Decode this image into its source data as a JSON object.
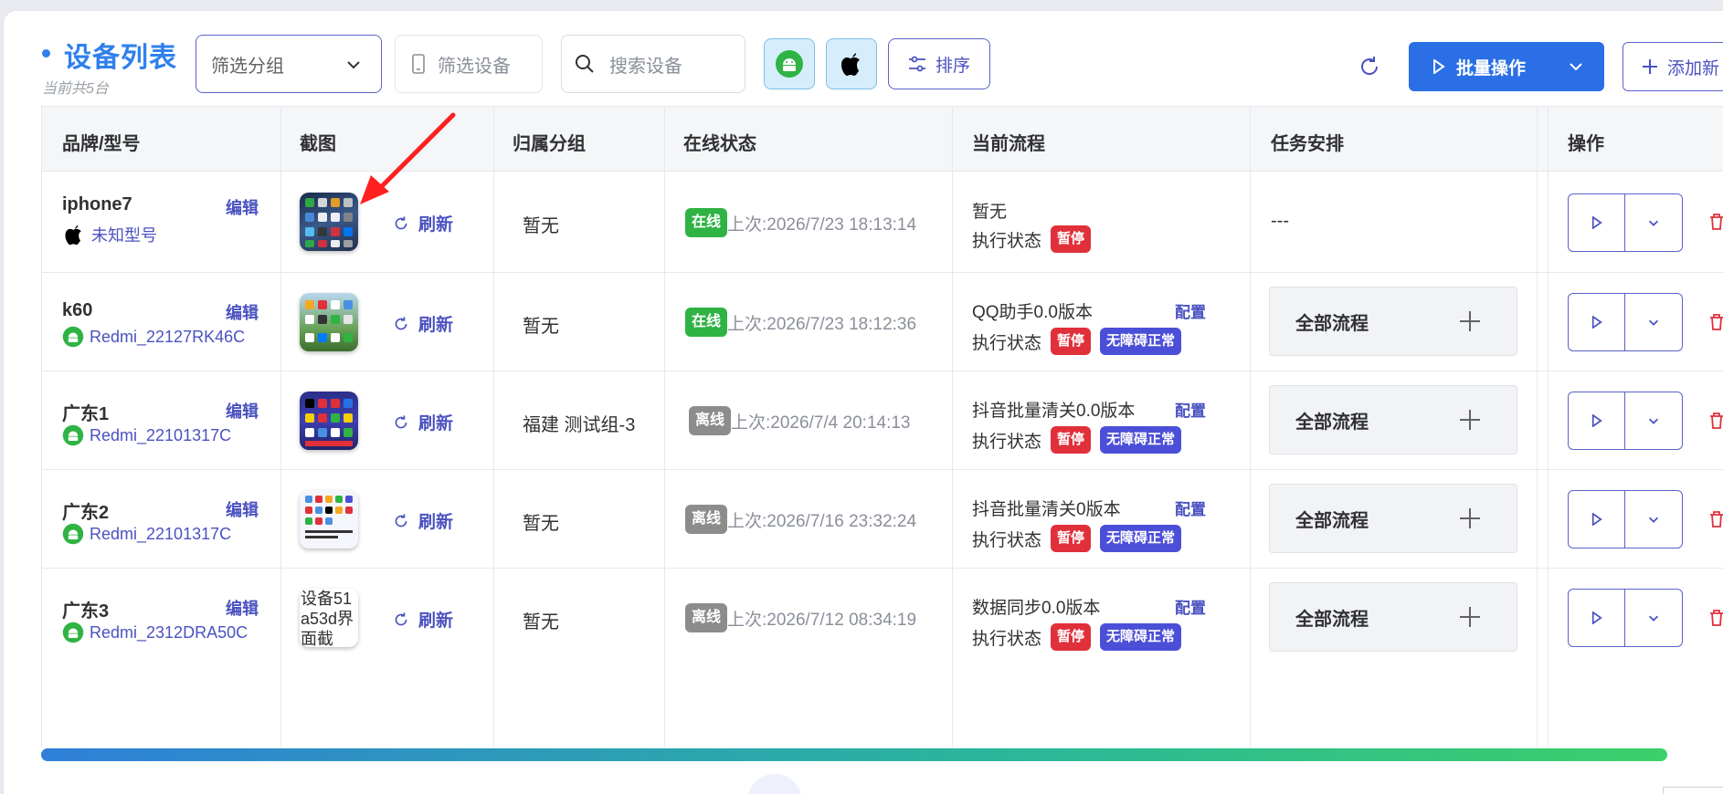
{
  "header": {
    "title": "设备列表",
    "subtitle": "当前共5台",
    "group_filter_placeholder": "筛选分组",
    "device_filter_placeholder": "筛选设备",
    "search_placeholder": "搜索设备",
    "sort_label": "排序",
    "batch_label": "批量操作",
    "add_label": "添加新"
  },
  "columns": [
    "品牌/型号",
    "截图",
    "归属分组",
    "在线状态",
    "当前流程",
    "任务安排",
    "操作"
  ],
  "common": {
    "edit": "编辑",
    "refresh": "刷新",
    "exec_state": "执行状态",
    "paused": "暂停",
    "accessibility_ok": "无障碍正常",
    "config": "配置",
    "all_flows": "全部流程"
  },
  "rows": [
    {
      "name": "iphone7",
      "os": "apple",
      "model": "未知型号",
      "group": "暂无",
      "status": "在线",
      "last": "上次:2026/7/23 18:13:14",
      "flow": "暂无",
      "task": "---"
    },
    {
      "name": "k60",
      "os": "android",
      "model": "Redmi_22127RK46C",
      "group": "暂无",
      "status": "在线",
      "last": "上次:2026/7/23 18:12:36",
      "flow": "QQ助手0.0版本",
      "task": "全部流程"
    },
    {
      "name": "广东1",
      "os": "android",
      "model": "Redmi_22101317C",
      "group": "福建 测试组-3",
      "status": "离线",
      "last": "上次:2026/7/4 20:14:13",
      "flow": "抖音批量清关0.0版本",
      "task": "全部流程"
    },
    {
      "name": "广东2",
      "os": "android",
      "model": "Redmi_22101317C",
      "group": "暂无",
      "status": "离线",
      "last": "上次:2026/7/16 23:32:24",
      "flow": "抖音批量清关0版本",
      "task": "全部流程"
    },
    {
      "name": "广东3",
      "os": "android",
      "model": "Redmi_2312DRA50C",
      "group": "暂无",
      "status": "离线",
      "last": "上次:2026/7/12 08:34:19",
      "flow": "数据同步0.0版本",
      "task": "全部流程"
    }
  ],
  "broken_image_alt": "设备51a53d界面截",
  "colors": {
    "accent": "#2f80ed",
    "primary_button": "#2b6fe6",
    "online": "#2fb344",
    "offline": "#8c8c8c",
    "paused": "#e0303a",
    "accessibility": "#4b4fd8"
  }
}
